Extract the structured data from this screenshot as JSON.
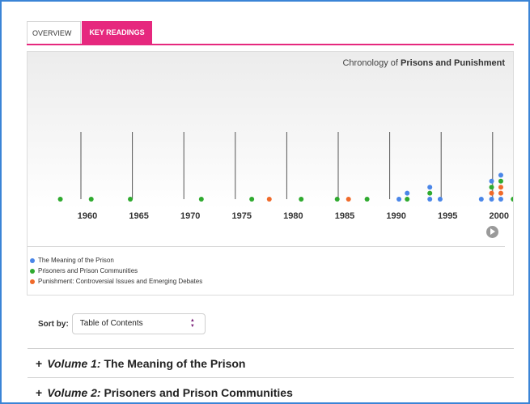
{
  "tabs": [
    {
      "label": "OVERVIEW",
      "active": false
    },
    {
      "label": "KEY READINGS",
      "active": true
    }
  ],
  "timeline": {
    "title_prefix": "Chronology of ",
    "title_bold": "Prisons and Punishment",
    "year_labels": [
      "1960",
      "1965",
      "1970",
      "1975",
      "1980",
      "1985",
      "1990",
      "1995",
      "2000"
    ],
    "colors": {
      "meaning": "#4a86e8",
      "prisoners": "#2faa2f",
      "punishment": "#f06a2a",
      "accent": "#e6287e"
    },
    "points": [
      {
        "series": "prisoners",
        "x": 1958.0,
        "stack": 0
      },
      {
        "series": "prisoners",
        "x": 1961.0,
        "stack": 0
      },
      {
        "series": "prisoners",
        "x": 1964.8,
        "stack": 0
      },
      {
        "series": "prisoners",
        "x": 1971.7,
        "stack": 0
      },
      {
        "series": "prisoners",
        "x": 1976.6,
        "stack": 0
      },
      {
        "series": "punishment",
        "x": 1978.3,
        "stack": 0
      },
      {
        "series": "prisoners",
        "x": 1981.4,
        "stack": 0
      },
      {
        "series": "prisoners",
        "x": 1984.9,
        "stack": 0
      },
      {
        "series": "punishment",
        "x": 1986.0,
        "stack": 0
      },
      {
        "series": "prisoners",
        "x": 1987.8,
        "stack": 0
      },
      {
        "series": "meaning",
        "x": 1990.9,
        "stack": 0
      },
      {
        "series": "prisoners",
        "x": 1991.7,
        "stack": 0
      },
      {
        "series": "meaning",
        "x": 1991.7,
        "stack": 1
      },
      {
        "series": "meaning",
        "x": 1993.9,
        "stack": 0
      },
      {
        "series": "prisoners",
        "x": 1993.9,
        "stack": 1
      },
      {
        "series": "meaning",
        "x": 1993.9,
        "stack": 2
      },
      {
        "series": "meaning",
        "x": 1994.9,
        "stack": 0
      },
      {
        "series": "meaning",
        "x": 1998.9,
        "stack": 0
      },
      {
        "series": "meaning",
        "x": 1999.9,
        "stack": 0
      },
      {
        "series": "punishment",
        "x": 1999.9,
        "stack": 1
      },
      {
        "series": "prisoners",
        "x": 1999.9,
        "stack": 2
      },
      {
        "series": "meaning",
        "x": 1999.9,
        "stack": 3
      },
      {
        "series": "meaning",
        "x": 2000.8,
        "stack": 0
      },
      {
        "series": "punishment",
        "x": 2000.8,
        "stack": 1
      },
      {
        "series": "punishment",
        "x": 2000.8,
        "stack": 2
      },
      {
        "series": "prisoners",
        "x": 2000.8,
        "stack": 3
      },
      {
        "series": "meaning",
        "x": 2000.8,
        "stack": 4
      },
      {
        "series": "prisoners",
        "x": 2002.0,
        "stack": 0
      }
    ],
    "legend": [
      {
        "label": "The Meaning of the Prison",
        "color": "#4a86e8"
      },
      {
        "label": "Prisoners and Prison Communities",
        "color": "#2faa2f"
      },
      {
        "label": "Punishment: Controversial Issues and Emerging Debates",
        "color": "#f06a2a"
      }
    ],
    "play_icon": "play-icon"
  },
  "sort": {
    "label": "Sort by:",
    "selected": "Table of Contents",
    "arrows_up": "▲",
    "arrows_down": "▼"
  },
  "volumes": [
    {
      "plus": "+",
      "number": "Volume 1:",
      "title": " The Meaning of the Prison"
    },
    {
      "plus": "+",
      "number": "Volume 2:",
      "title": " Prisoners and Prison Communities"
    }
  ]
}
